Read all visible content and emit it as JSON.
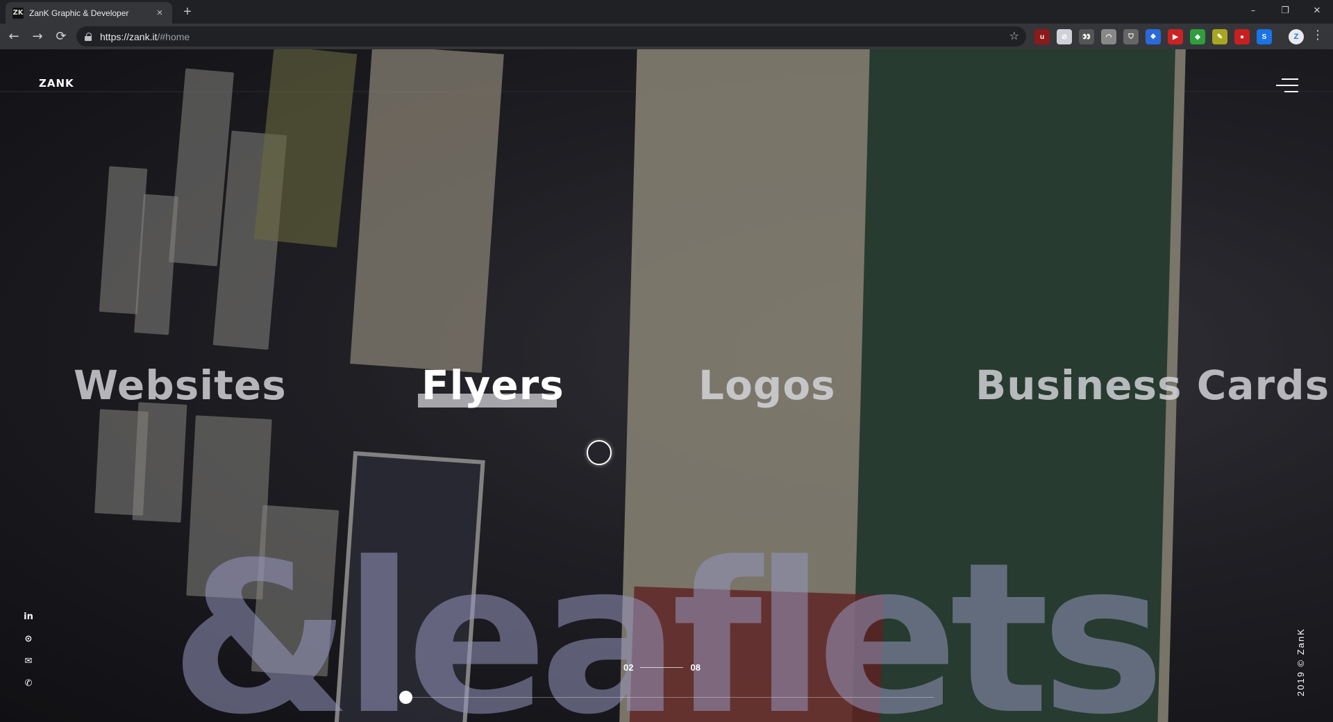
{
  "browser": {
    "tab_title": "ZanK Graphic & Developer",
    "tab_favicon": "ZK",
    "tab_close": "×",
    "new_tab": "+",
    "window_controls": {
      "minimize": "–",
      "restore": "❐",
      "close": "✕"
    },
    "nav": {
      "back": "←",
      "forward": "→",
      "reload": "⟳"
    },
    "url_host": "https://zank.it",
    "url_path": "/#home",
    "bookmark_icon": "☆",
    "extensions": [
      {
        "name": "ublock-icon",
        "color": "#8b1a1a",
        "glyph": "u"
      },
      {
        "name": "block-icon",
        "color": "#d0d0d8",
        "glyph": "⊘"
      },
      {
        "name": "eyes-icon",
        "color": "#555",
        "glyph": "👀"
      },
      {
        "name": "arc-icon",
        "color": "#888",
        "glyph": "◠"
      },
      {
        "name": "shield-icon",
        "color": "#666",
        "glyph": "⛉"
      },
      {
        "name": "bluebox-icon",
        "color": "#2a6ad8",
        "glyph": "❖"
      },
      {
        "name": "redflag-icon",
        "color": "#c22",
        "glyph": "▶"
      },
      {
        "name": "greenleaf-icon",
        "color": "#2e9e3e",
        "glyph": "◆"
      },
      {
        "name": "yellow-icon",
        "color": "#a6a620",
        "glyph": "✎"
      },
      {
        "name": "ladybug-icon",
        "color": "#c82020",
        "glyph": "●"
      },
      {
        "name": "s-icon",
        "color": "#1a73e8",
        "glyph": "S"
      }
    ],
    "profile_initials": "Z",
    "menu_icon": "⋮"
  },
  "site": {
    "brand": "ZANK",
    "categories": [
      {
        "label": "Websites",
        "active": false
      },
      {
        "label": "Flyers",
        "active": true
      },
      {
        "label": "Logos",
        "active": false
      },
      {
        "label": "Business Cards",
        "active": false
      }
    ],
    "big_word": "&leaflets",
    "socials": [
      {
        "name": "linkedin-icon",
        "glyph": "in"
      },
      {
        "name": "github-icon",
        "glyph": "⊙"
      },
      {
        "name": "mail-icon",
        "glyph": "✉"
      },
      {
        "name": "whatsapp-icon",
        "glyph": "✆"
      }
    ],
    "counter_current": "02",
    "counter_total": "08",
    "progress": 0.0,
    "copyright": "2019 © ZanK"
  }
}
